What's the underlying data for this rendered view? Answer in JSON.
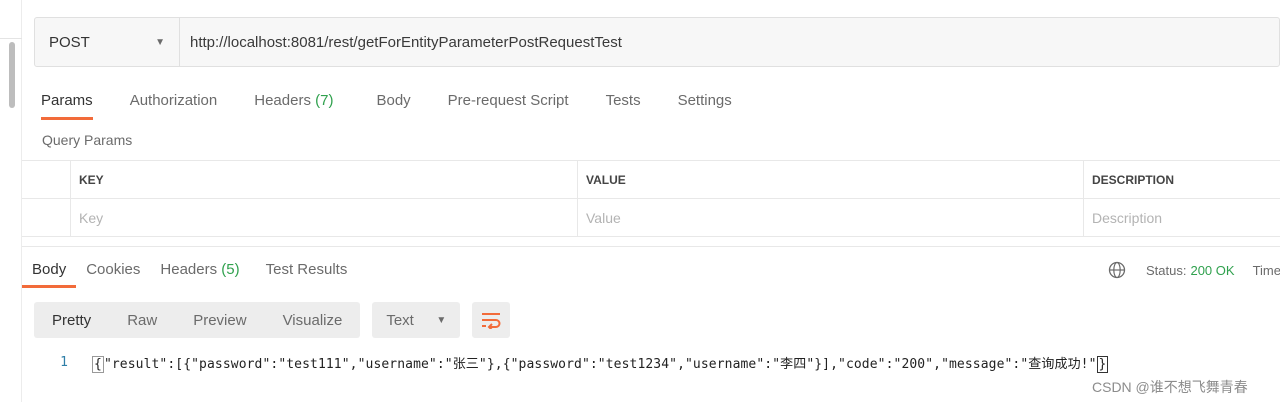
{
  "request": {
    "method": "POST",
    "url": "http://localhost:8081/rest/getForEntityParameterPostRequestTest"
  },
  "request_tabs": [
    {
      "label": "Params",
      "count": ""
    },
    {
      "label": "Authorization",
      "count": ""
    },
    {
      "label": "Headers",
      "count": "(7)"
    },
    {
      "label": "Body",
      "count": ""
    },
    {
      "label": "Pre-request Script",
      "count": ""
    },
    {
      "label": "Tests",
      "count": ""
    },
    {
      "label": "Settings",
      "count": ""
    }
  ],
  "query_params": {
    "label": "Query Params",
    "columns": [
      "KEY",
      "VALUE",
      "DESCRIPTION"
    ],
    "placeholders": [
      "Key",
      "Value",
      "Description"
    ]
  },
  "response_tabs": [
    {
      "label": "Body",
      "count": ""
    },
    {
      "label": "Cookies",
      "count": ""
    },
    {
      "label": "Headers",
      "count": "(5)"
    },
    {
      "label": "Test Results",
      "count": ""
    }
  ],
  "status": {
    "label": "Status:",
    "value": "200 OK",
    "time_label": "Time"
  },
  "view_modes": [
    "Pretty",
    "Raw",
    "Preview",
    "Visualize"
  ],
  "format": "Text",
  "response_body": {
    "line_number": "1",
    "open_brace": "{",
    "content": "\"result\":[{\"password\":\"test111\",\"username\":\"张三\"},{\"password\":\"test1234\",\"username\":\"李四\"}],\"code\":\"200\",\"message\":\"查询成功!\"",
    "close_brace": "}"
  },
  "watermark": "CSDN @谁不想飞舞青春",
  "colors": {
    "accent": "#f26b3a",
    "success": "#30a14e",
    "line_number": "#2f7fa8"
  },
  "icons": {
    "method_dropdown": "chevron-down-icon",
    "network": "globe-icon",
    "wrap": "wrap-lines-icon"
  }
}
